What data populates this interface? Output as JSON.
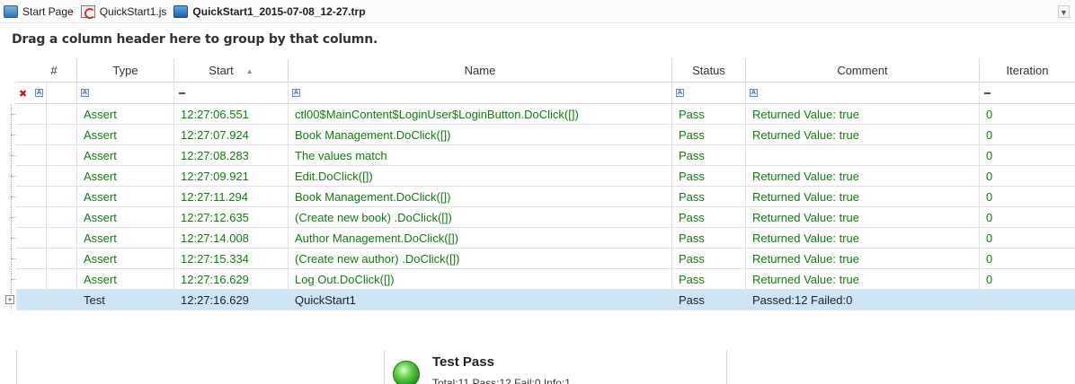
{
  "tabs": [
    {
      "label": "Start Page",
      "icon": "start-page-icon",
      "active": false
    },
    {
      "label": "QuickStart1.js",
      "icon": "js-file-icon",
      "active": false
    },
    {
      "label": "QuickStart1_2015-07-08_12-27.trp",
      "icon": "trp-file-icon",
      "active": true
    }
  ],
  "group_panel": {
    "text": "Drag a column header here to group by that column."
  },
  "grid": {
    "columns": [
      {
        "key": "num",
        "label": "#"
      },
      {
        "key": "type",
        "label": "Type"
      },
      {
        "key": "start",
        "label": "Start",
        "sort": "ascending"
      },
      {
        "key": "name",
        "label": "Name"
      },
      {
        "key": "status",
        "label": "Status"
      },
      {
        "key": "comment",
        "label": "Comment"
      },
      {
        "key": "iteration",
        "label": "Iteration"
      }
    ],
    "rows": [
      {
        "type": "Assert",
        "start": "12:27:06.551",
        "name": "ctl00$MainContent$LoginUser$LoginButton.DoClick([])",
        "status": "Pass",
        "comment": "Returned Value: true",
        "iteration": "0"
      },
      {
        "type": "Assert",
        "start": "12:27:07.924",
        "name": "Book Management.DoClick([])",
        "status": "Pass",
        "comment": "Returned Value: true",
        "iteration": "0"
      },
      {
        "type": "Assert",
        "start": "12:27:08.283",
        "name": "The values match",
        "status": "Pass",
        "comment": "",
        "iteration": "0"
      },
      {
        "type": "Assert",
        "start": "12:27:09.921",
        "name": "Edit.DoClick([])",
        "status": "Pass",
        "comment": "Returned Value: true",
        "iteration": "0"
      },
      {
        "type": "Assert",
        "start": "12:27:11.294",
        "name": "Book Management.DoClick([])",
        "status": "Pass",
        "comment": "Returned Value: true",
        "iteration": "0"
      },
      {
        "type": "Assert",
        "start": "12:27:12.635",
        "name": " (Create new book) .DoClick([])",
        "status": "Pass",
        "comment": "Returned Value: true",
        "iteration": "0"
      },
      {
        "type": "Assert",
        "start": "12:27:14.008",
        "name": "Author Management.DoClick([])",
        "status": "Pass",
        "comment": "Returned Value: true",
        "iteration": "0"
      },
      {
        "type": "Assert",
        "start": "12:27:15.334",
        "name": " (Create new author) .DoClick([])",
        "status": "Pass",
        "comment": "Returned Value: true",
        "iteration": "0"
      },
      {
        "type": "Assert",
        "start": "12:27:16.629",
        "name": "Log Out.DoClick([])",
        "status": "Pass",
        "comment": "Returned Value: true",
        "iteration": "0"
      }
    ],
    "selected_row": {
      "type": "Test",
      "start": "12:27:16.629",
      "name": "QuickStart1",
      "status": "Pass",
      "comment": "Passed:12 Failed:0",
      "iteration": ""
    }
  },
  "summary": {
    "title": "Test Pass",
    "detail": "Total:11 Pass:12 Fail:0 Info:1",
    "icon": "pass-status-icon"
  },
  "colors": {
    "pass_text": "#137a13",
    "selected_row": "#cde6f7"
  }
}
